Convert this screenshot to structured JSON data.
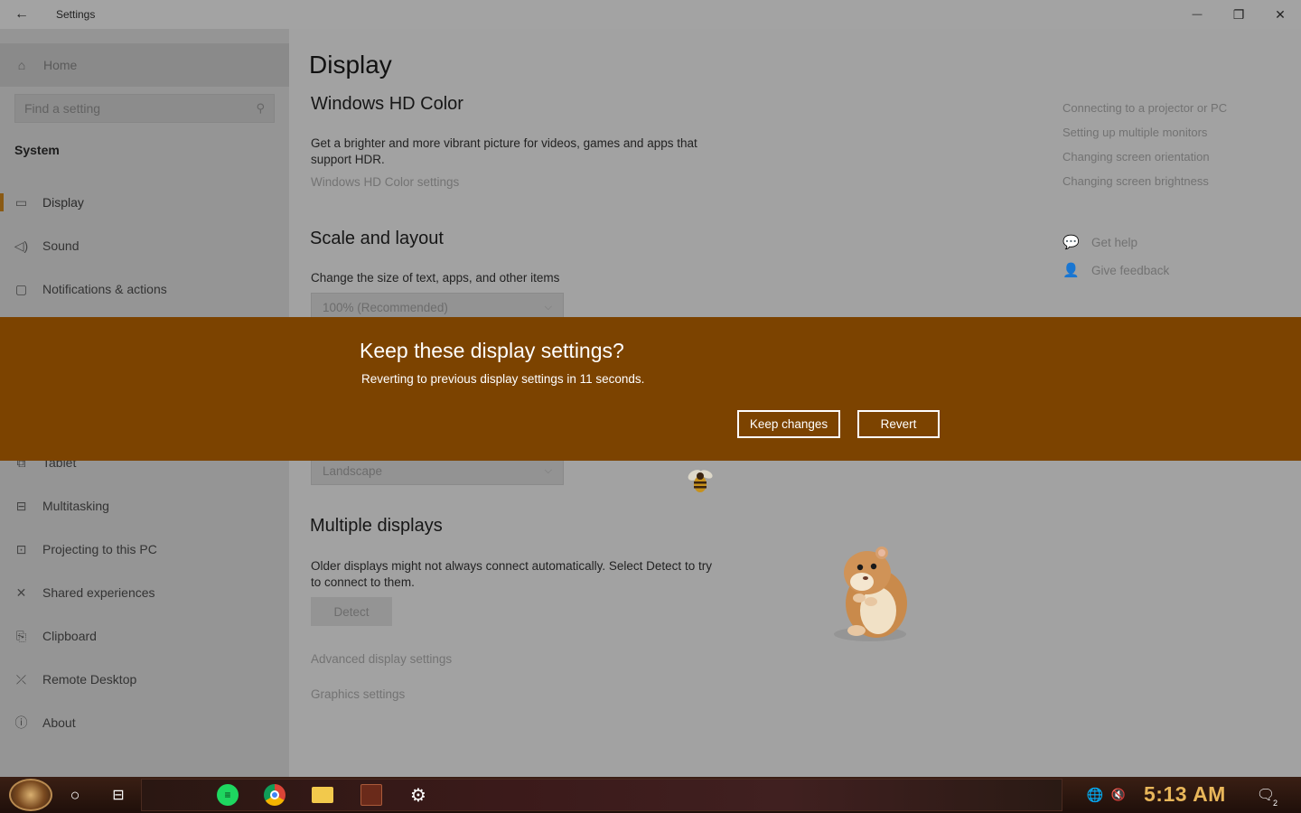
{
  "window": {
    "title": "Settings",
    "back_glyph": "←",
    "minimize_glyph": "—",
    "maximize_glyph": "❐",
    "close_glyph": "✕"
  },
  "sidebar": {
    "home_label": "Home",
    "search_placeholder": "Find a setting",
    "section_label": "System",
    "items": [
      {
        "label": "Display",
        "icon": "monitor-icon"
      },
      {
        "label": "Sound",
        "icon": "speaker-icon"
      },
      {
        "label": "Notifications & actions",
        "icon": "notification-icon"
      },
      {
        "label": "Tablet",
        "icon": "tablet-icon"
      },
      {
        "label": "Multitasking",
        "icon": "multitasking-icon"
      },
      {
        "label": "Projecting to this PC",
        "icon": "projector-icon"
      },
      {
        "label": "Shared experiences",
        "icon": "share-icon"
      },
      {
        "label": "Clipboard",
        "icon": "clipboard-icon"
      },
      {
        "label": "Remote Desktop",
        "icon": "remote-desktop-icon"
      },
      {
        "label": "About",
        "icon": "info-icon"
      }
    ]
  },
  "main": {
    "page_title": "Display",
    "hdr": {
      "heading": "Windows HD Color",
      "description": "Get a brighter and more vibrant picture for videos, games and apps that support HDR.",
      "link": "Windows HD Color settings"
    },
    "scale": {
      "heading": "Scale and layout",
      "label": "Change the size of text, apps, and other items",
      "dropdown_value": "100% (Recommended)",
      "orientation_value": "Landscape"
    },
    "multiple": {
      "heading": "Multiple displays",
      "description": "Older displays might not always connect automatically. Select Detect to try to connect to them.",
      "detect_label": "Detect",
      "advanced_link": "Advanced display settings",
      "graphics_link": "Graphics settings"
    },
    "related": {
      "links": [
        "Connecting to a projector or PC",
        "Setting up multiple monitors",
        "Changing screen orientation",
        "Changing screen brightness"
      ],
      "get_help": "Get help",
      "give_feedback": "Give feedback"
    }
  },
  "dialog": {
    "title": "Keep these display settings?",
    "message": "Reverting to previous display settings in 11 seconds.",
    "keep_label": "Keep changes",
    "revert_label": "Revert",
    "background_color": "#7c4300"
  },
  "taskbar": {
    "clock": "5:13 AM",
    "notification_count": "2",
    "pinned_apps": [
      "spotify-icon",
      "chrome-icon",
      "file-explorer-icon",
      "photo-app-icon",
      "settings-icon"
    ]
  }
}
